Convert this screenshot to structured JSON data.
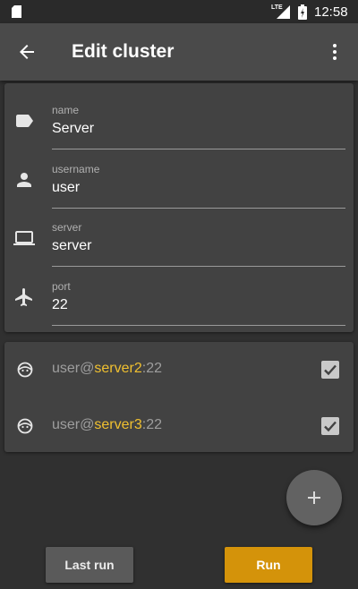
{
  "status_bar": {
    "network": "LTE",
    "time": "12:58"
  },
  "app_bar": {
    "title": "Edit cluster",
    "back_icon": "arrow-left-icon",
    "menu_icon": "more-vert-icon"
  },
  "form": {
    "fields": [
      {
        "label": "name",
        "value": "Server",
        "icon": "label-tag-icon"
      },
      {
        "label": "username",
        "value": "user",
        "icon": "person-icon"
      },
      {
        "label": "server",
        "value": "server",
        "icon": "laptop-icon"
      },
      {
        "label": "port",
        "value": "22",
        "icon": "airplane-icon"
      }
    ]
  },
  "hosts": [
    {
      "user": "user",
      "at": "@",
      "server": "server2",
      "sep": ":",
      "port": "22",
      "checked": true
    },
    {
      "user": "user",
      "at": "@",
      "server": "server3",
      "sep": ":",
      "port": "22",
      "checked": true
    }
  ],
  "fab": {
    "icon": "plus-icon"
  },
  "actions": {
    "last_run_label": "Last run",
    "run_label": "Run"
  },
  "colors": {
    "accent": "#d4930a",
    "highlight": "#f0c030",
    "background": "#303030"
  }
}
